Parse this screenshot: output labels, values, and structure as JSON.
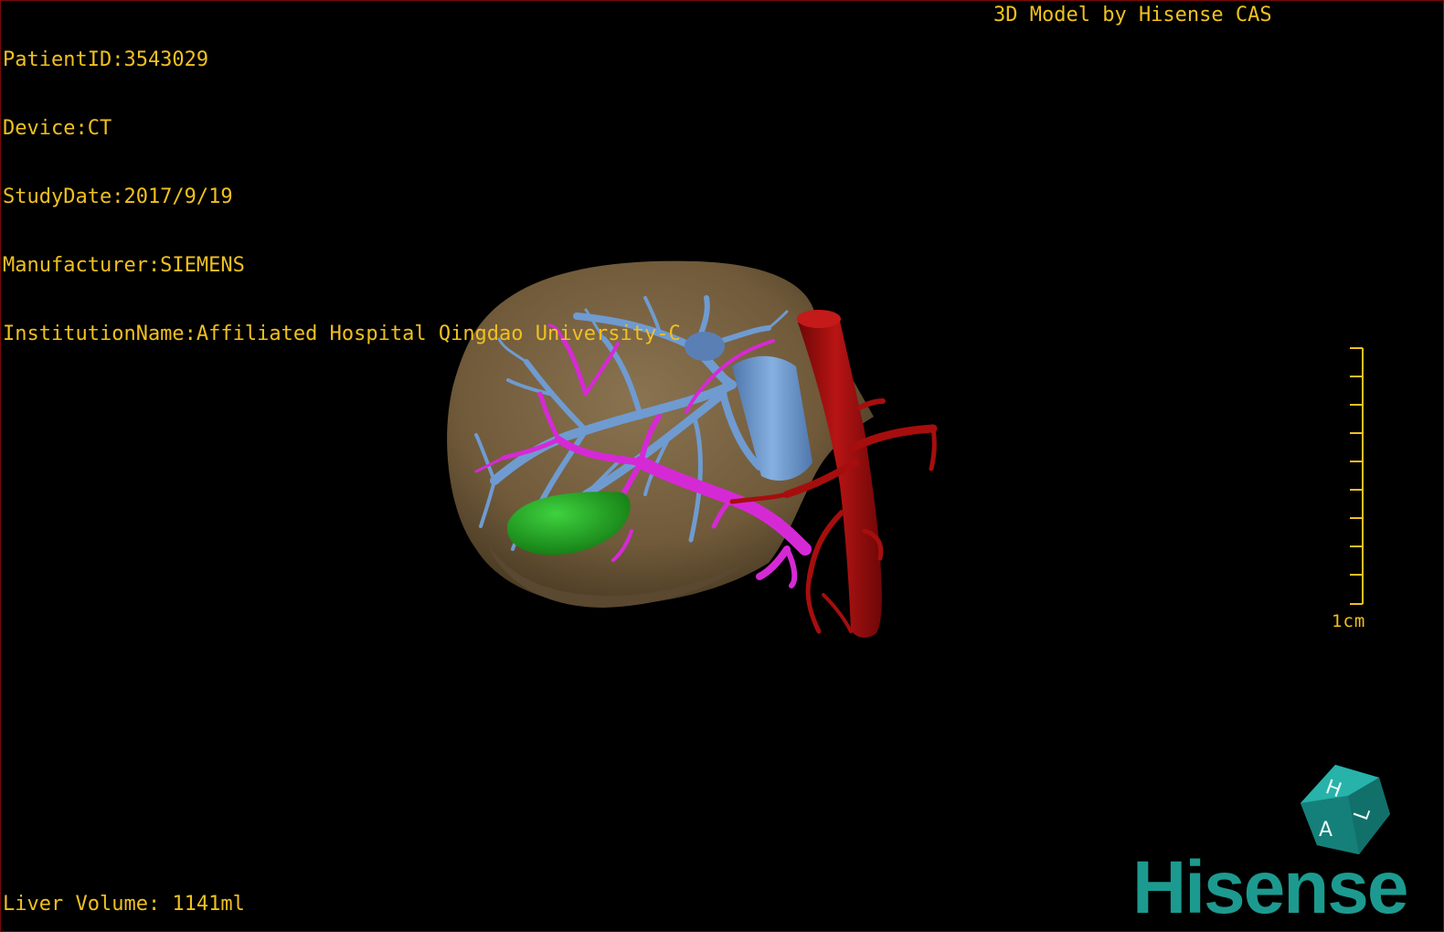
{
  "header": {
    "patient_id": "PatientID:3543029",
    "device": "Device:CT",
    "study_date": "StudyDate:2017/9/19",
    "manufacturer": "Manufacturer:SIEMENS",
    "institution": "InstitutionName:Affiliated Hospital Qingdao University-C"
  },
  "credit": "3D Model by Hisense CAS",
  "footer": {
    "liver_volume": "Liver Volume: 1141ml"
  },
  "scale": {
    "label": "1cm"
  },
  "orientation_cube": {
    "top_letter": "H",
    "side_letter": "A",
    "right_letter": "L"
  },
  "brand": {
    "name": "Hisense",
    "color": "#1d9a8f"
  },
  "model_colors": {
    "liver": "#7a6342",
    "hepatic_vein": "#6f9bd1",
    "portal_vein": "#d629d6",
    "artery_aorta": "#a60e0e",
    "gallbladder": "#1fa81f",
    "text": "#f0c020"
  }
}
